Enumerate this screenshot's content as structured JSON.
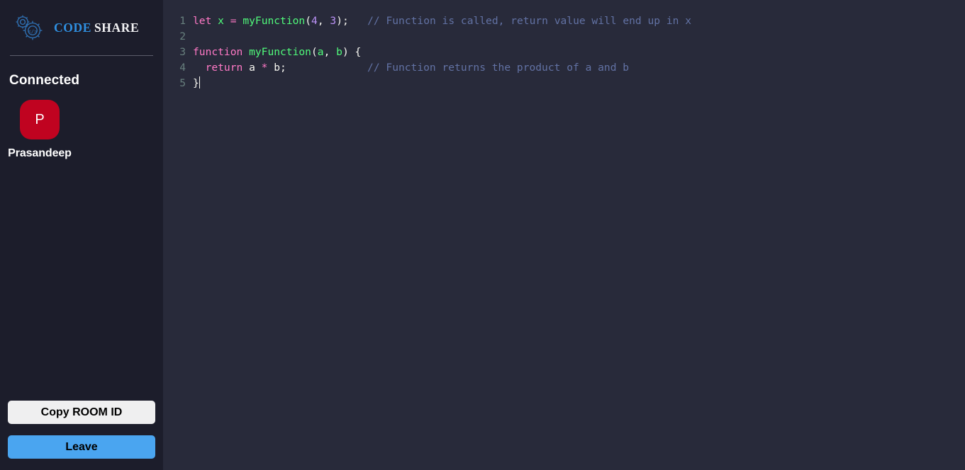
{
  "app": {
    "brand": {
      "icon": "gears-code-icon",
      "part1": "CODE",
      "part2": "SHARE",
      "part1_color": "#2f8fe0",
      "part2_color": "#f2f2f4"
    }
  },
  "sidebar": {
    "connected_label": "Connected",
    "clients": [
      {
        "initial": "P",
        "name": "Prasandeep",
        "avatar_color": "#c00320"
      }
    ],
    "actions": {
      "copy_label": "Copy ROOM ID",
      "leave_label": "Leave",
      "copy_color": "#efeff0",
      "leave_color": "#4aa5f0"
    }
  },
  "editor": {
    "theme_background": "#282a3a",
    "gutter_color": "#68807e",
    "lines": [
      {
        "number": "1",
        "tokens": [
          {
            "t": "let",
            "c": "kw"
          },
          {
            "t": " ",
            "c": "plain"
          },
          {
            "t": "x",
            "c": "var"
          },
          {
            "t": " ",
            "c": "plain"
          },
          {
            "t": "=",
            "c": "kw"
          },
          {
            "t": " ",
            "c": "plain"
          },
          {
            "t": "myFunction",
            "c": "fn"
          },
          {
            "t": "(",
            "c": "plain"
          },
          {
            "t": "4",
            "c": "num"
          },
          {
            "t": ", ",
            "c": "plain"
          },
          {
            "t": "3",
            "c": "num"
          },
          {
            "t": ");",
            "c": "plain"
          },
          {
            "t": "   ",
            "c": "plain"
          },
          {
            "t": "// Function is called, return value will end up in x",
            "c": "cmt"
          }
        ]
      },
      {
        "number": "2",
        "tokens": []
      },
      {
        "number": "3",
        "tokens": [
          {
            "t": "function",
            "c": "kw"
          },
          {
            "t": " ",
            "c": "plain"
          },
          {
            "t": "myFunction",
            "c": "fn"
          },
          {
            "t": "(",
            "c": "plain"
          },
          {
            "t": "a",
            "c": "var"
          },
          {
            "t": ", ",
            "c": "plain"
          },
          {
            "t": "b",
            "c": "var"
          },
          {
            "t": ") {",
            "c": "plain"
          }
        ]
      },
      {
        "number": "4",
        "tokens": [
          {
            "t": "  ",
            "c": "plain"
          },
          {
            "t": "return",
            "c": "kw"
          },
          {
            "t": " a ",
            "c": "plain"
          },
          {
            "t": "*",
            "c": "kw"
          },
          {
            "t": " b;",
            "c": "plain"
          },
          {
            "t": "             ",
            "c": "plain"
          },
          {
            "t": "// Function returns the product of a and b",
            "c": "cmt"
          }
        ]
      },
      {
        "number": "5",
        "tokens": [
          {
            "t": "}",
            "c": "plain"
          }
        ],
        "caret": true
      }
    ]
  }
}
